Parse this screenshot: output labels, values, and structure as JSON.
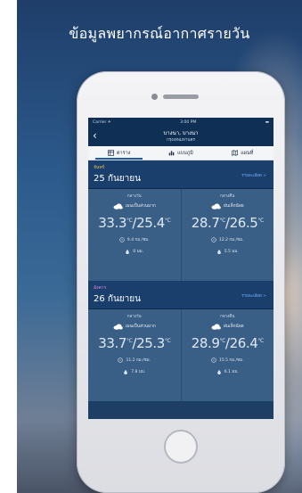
{
  "poster": {
    "headline": "ข้อมูลพยากรณ์อากาศรายวัน"
  },
  "status_bar": {
    "carrier": "Carrier ✈",
    "time": "3:00 PM",
    "battery": "▬"
  },
  "nav": {
    "back_icon": "chevron-left-icon",
    "title": "บางนา, บางนา",
    "subtitle": "กรุงเทพมหานคร"
  },
  "tabs": [
    {
      "label": "ตาราง",
      "icon": "table-icon",
      "active": true
    },
    {
      "label": "แบบภูมิ",
      "icon": "bar-chart-icon",
      "active": false
    },
    {
      "label": "แผนที่",
      "icon": "map-icon",
      "active": false
    }
  ],
  "days": [
    {
      "day_name": "จันทร์",
      "day_color": "#f0c24a",
      "date": "25 กันยายน",
      "detail_link": "รายละเอียด >",
      "periods": [
        {
          "period": "กลางวัน",
          "condition": "เมฆเป็นส่วนมาก",
          "high": "33.3",
          "low": "25.4",
          "unit": "°C",
          "wind": "9.4 กม./ชม.",
          "rain": "0 มม."
        },
        {
          "period": "กลางคืน",
          "condition": "ฝนเล็กน้อย",
          "high": "28.7",
          "low": "26.5",
          "unit": "°C",
          "wind": "12.2 กม./ชม.",
          "rain": "5.5 มม."
        }
      ]
    },
    {
      "day_name": "อังคาร",
      "day_color": "#e58adf",
      "date": "26 กันยายน",
      "detail_link": "รายละเอียด >",
      "periods": [
        {
          "period": "กลางวัน",
          "condition": "เมฆเป็นส่วนมาก",
          "high": "33.7",
          "low": "25.3",
          "unit": "°C",
          "wind": "11.2 กม./ชม.",
          "rain": "7.8 มม."
        },
        {
          "period": "กลางคืน",
          "condition": "ฝนเล็กน้อย",
          "high": "28.9",
          "low": "26.4",
          "unit": "°C",
          "wind": "15.5 กม./ชม.",
          "rain": "6.1 มม."
        }
      ]
    }
  ],
  "colors": {
    "accent": "#1f5d9f",
    "card": "#3a5f86",
    "nav": "#0f2f55",
    "link": "#6fb0ff"
  }
}
